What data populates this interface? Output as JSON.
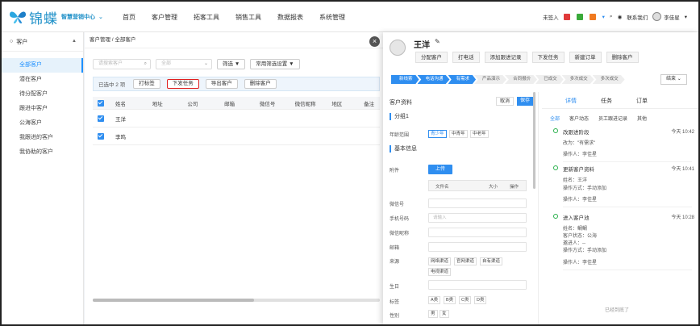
{
  "brand": {
    "logo": "锦蝶",
    "subtitle": "智慧营销中心"
  },
  "nav": [
    "首页",
    "客户管理",
    "拓客工具",
    "销售工具",
    "数据报表",
    "系统管理"
  ],
  "topright": {
    "signin": "未签入",
    "contact": "联系我们",
    "user": "李佳星"
  },
  "sidebar": {
    "header": "客户",
    "items": [
      "全部客户",
      "潜在客户",
      "待分配客户",
      "跟进中客户",
      "公海客户",
      "我跟进的客户",
      "我协助的客户"
    ]
  },
  "breadcrumb": "客户管理 / 全部客户",
  "filters": {
    "search_placeholder": "请搜索客户",
    "select_value": "全部",
    "filter_btn": "筛选",
    "common_filter": "常用筛选设置"
  },
  "selection": {
    "count": "已选中 2 项",
    "actions": [
      "打标签",
      "下发任务",
      "导出客户",
      "删除客户"
    ]
  },
  "table": {
    "headers": [
      "姓名",
      "地址",
      "公司",
      "邮箱",
      "微信号",
      "微信昵称",
      "地区",
      "备注"
    ],
    "rows": [
      {
        "name": "王洋"
      },
      {
        "name": "李鸣"
      }
    ]
  },
  "panel": {
    "name": "王洋",
    "actions": [
      "分配客户",
      "打电话",
      "添加跟进记录",
      "下发任务",
      "新建订单",
      "删除客户"
    ],
    "stages": [
      "新线索",
      "电话沟通",
      "有需求",
      "产品演示",
      "合同报价",
      "已成交",
      "多次成交",
      "多次成交"
    ],
    "end_btn": "结束",
    "form": {
      "title": "客户资料",
      "cancel": "取消",
      "save": "保存",
      "group": "分组1",
      "age_label": "年龄范围",
      "age_opts": [
        "青少年",
        "中青年",
        "中老年"
      ],
      "basic": "基本信息",
      "attach": "附件",
      "upload": "上传",
      "file_cols": [
        "文件名",
        "大小",
        "操作"
      ],
      "wechat": "微信号",
      "phone": "手机号码",
      "phone_ph": "请输入",
      "wechat_nick": "微信昵称",
      "email": "邮箱",
      "source": "来源",
      "source_opts": [
        "网络渠道",
        "官网渠道",
        "自有渠道",
        "电视渠道"
      ],
      "birthday": "生日",
      "tags_label": "标签",
      "tags": [
        "A类",
        "B类",
        "C类",
        "D类"
      ],
      "gender": "性别",
      "gender_opts": [
        "男",
        "女"
      ]
    },
    "tabs": [
      "详情",
      "任务",
      "订单"
    ],
    "subtabs": [
      "全部",
      "客户动态",
      "员工跟进记录",
      "其他"
    ],
    "timeline": [
      {
        "title": "改跟进阶段",
        "time": "今天 10:42",
        "lines": [
          "改为：\"有需求\"",
          "操作人：李佳星"
        ]
      },
      {
        "title": "更新客户资料",
        "time": "今天 10:41",
        "lines": [
          "姓名：王洋",
          "操作方式：手动添加",
          "操作人：李佳星"
        ]
      },
      {
        "title": "进入客户池",
        "time": "今天 10:28",
        "lines": [
          "姓名：鲷鲷",
          "客户状态：公海",
          "邀进人：--",
          "操作方式：手动添加",
          "操作人：李佳星"
        ]
      }
    ],
    "end_text": "已经到底了"
  }
}
